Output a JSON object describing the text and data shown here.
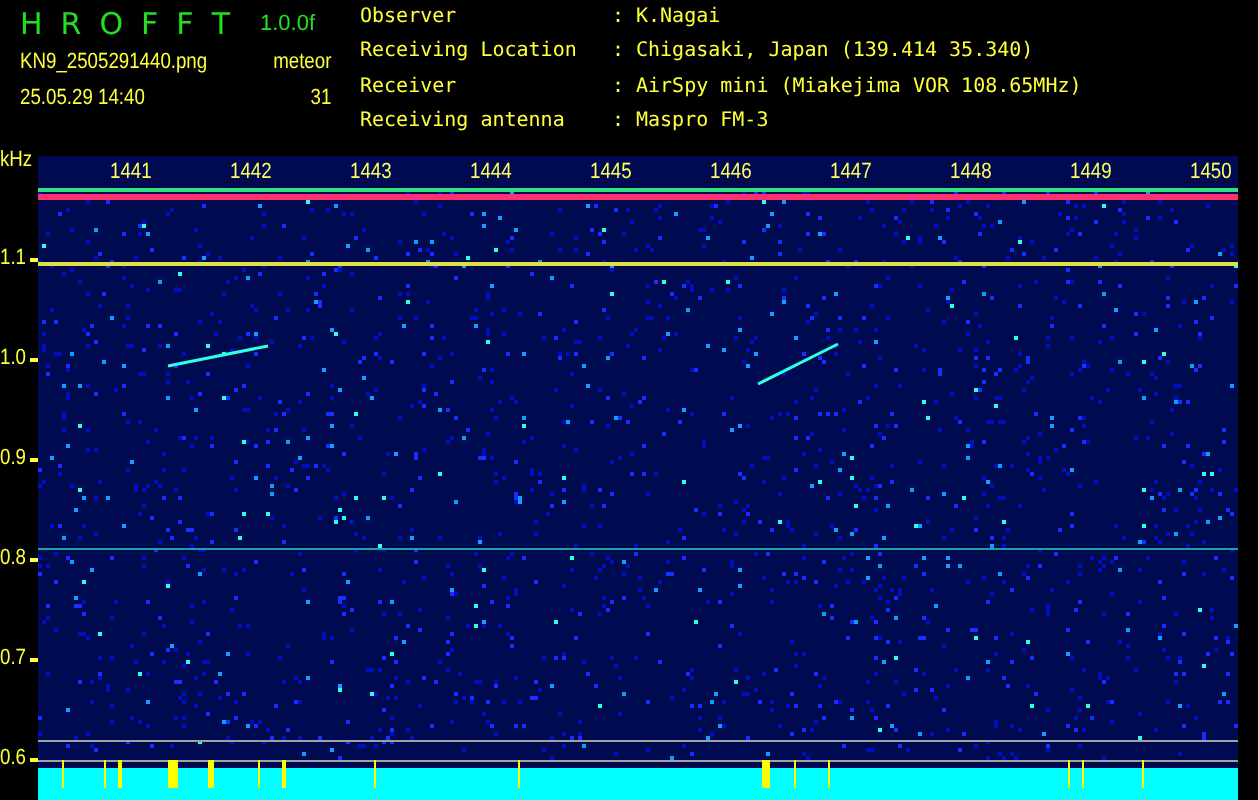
{
  "header": {
    "title_letters": [
      "H",
      "R",
      "O",
      "F",
      "F",
      "T"
    ],
    "version": "1.0.0f",
    "filename": "KN9_2505291440.png",
    "timestamp": "25.05.29 14:40",
    "mode": "meteor",
    "count": "31"
  },
  "info": [
    {
      "label": "Observer",
      "separator": ":",
      "value": "K.Nagai"
    },
    {
      "label": "Receiving Location",
      "separator": ":",
      "value": "Chigasaki, Japan (139.414 35.340)"
    },
    {
      "label": "Receiver",
      "separator": ":",
      "value": "AirSpy mini (Miakejima VOR 108.65MHz)"
    },
    {
      "label": "Receiving antenna",
      "separator": ":",
      "value": "Maspro FM-3"
    }
  ],
  "spectrogram": {
    "unit": "kHz",
    "y_ticks": [
      "1.1",
      "1.0",
      "0.9",
      "0.8",
      "0.7",
      "0.6"
    ],
    "time_labels": [
      "1441",
      "1442",
      "1443",
      "1444",
      "1445",
      "1446",
      "1447",
      "1448",
      "1449",
      "1450"
    ]
  }
}
